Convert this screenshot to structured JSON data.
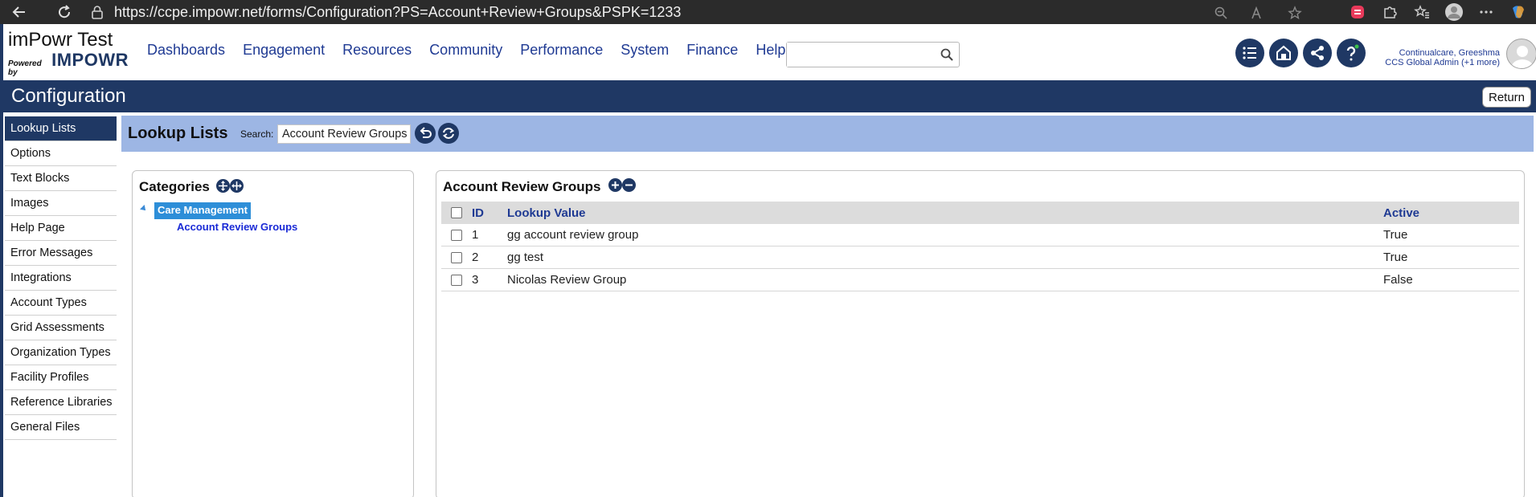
{
  "browser": {
    "url": "https://ccpe.impowr.net/forms/Configuration?PS=Account+Review+Groups&PSPK=1233"
  },
  "app": {
    "logo_title": "imPowr Test",
    "logo_powered": "Powered by",
    "logo_brand": "IMPOWR",
    "menu": [
      "Dashboards",
      "Engagement",
      "Resources",
      "Community",
      "Performance",
      "System",
      "Finance",
      "Help"
    ],
    "search_placeholder": "",
    "user_name": "Continualcare, Greeshma",
    "user_role": "CCS Global Admin (+1 more)"
  },
  "page": {
    "title": "Configuration",
    "return_label": "Return"
  },
  "sidebar": {
    "items": [
      {
        "label": "Lookup Lists",
        "active": true
      },
      {
        "label": "Options"
      },
      {
        "label": "Text Blocks"
      },
      {
        "label": "Images"
      },
      {
        "label": "Help Page"
      },
      {
        "label": "Error Messages"
      },
      {
        "label": "Integrations"
      },
      {
        "label": "Account Types"
      },
      {
        "label": "Grid Assessments"
      },
      {
        "label": "Organization Types"
      },
      {
        "label": "Facility Profiles"
      },
      {
        "label": "Reference Libraries"
      },
      {
        "label": "General Files"
      }
    ]
  },
  "main": {
    "title": "Lookup Lists",
    "search_label": "Search:",
    "search_value": "Account Review Groups"
  },
  "categories": {
    "title": "Categories",
    "root": "Care Management",
    "child": "Account Review Groups"
  },
  "grid": {
    "title": "Account Review Groups",
    "columns": {
      "id": "ID",
      "value": "Lookup Value",
      "active": "Active"
    },
    "rows": [
      {
        "id": "1",
        "value": "gg account review group",
        "active": "True"
      },
      {
        "id": "2",
        "value": "gg test",
        "active": "True"
      },
      {
        "id": "3",
        "value": "Nicolas Review Group",
        "active": "False"
      }
    ]
  },
  "colors": {
    "navy": "#1f3864",
    "light_blue_bar": "#9db6e4",
    "link_blue": "#1f3a93",
    "tree_highlight": "#2d8ed8"
  }
}
